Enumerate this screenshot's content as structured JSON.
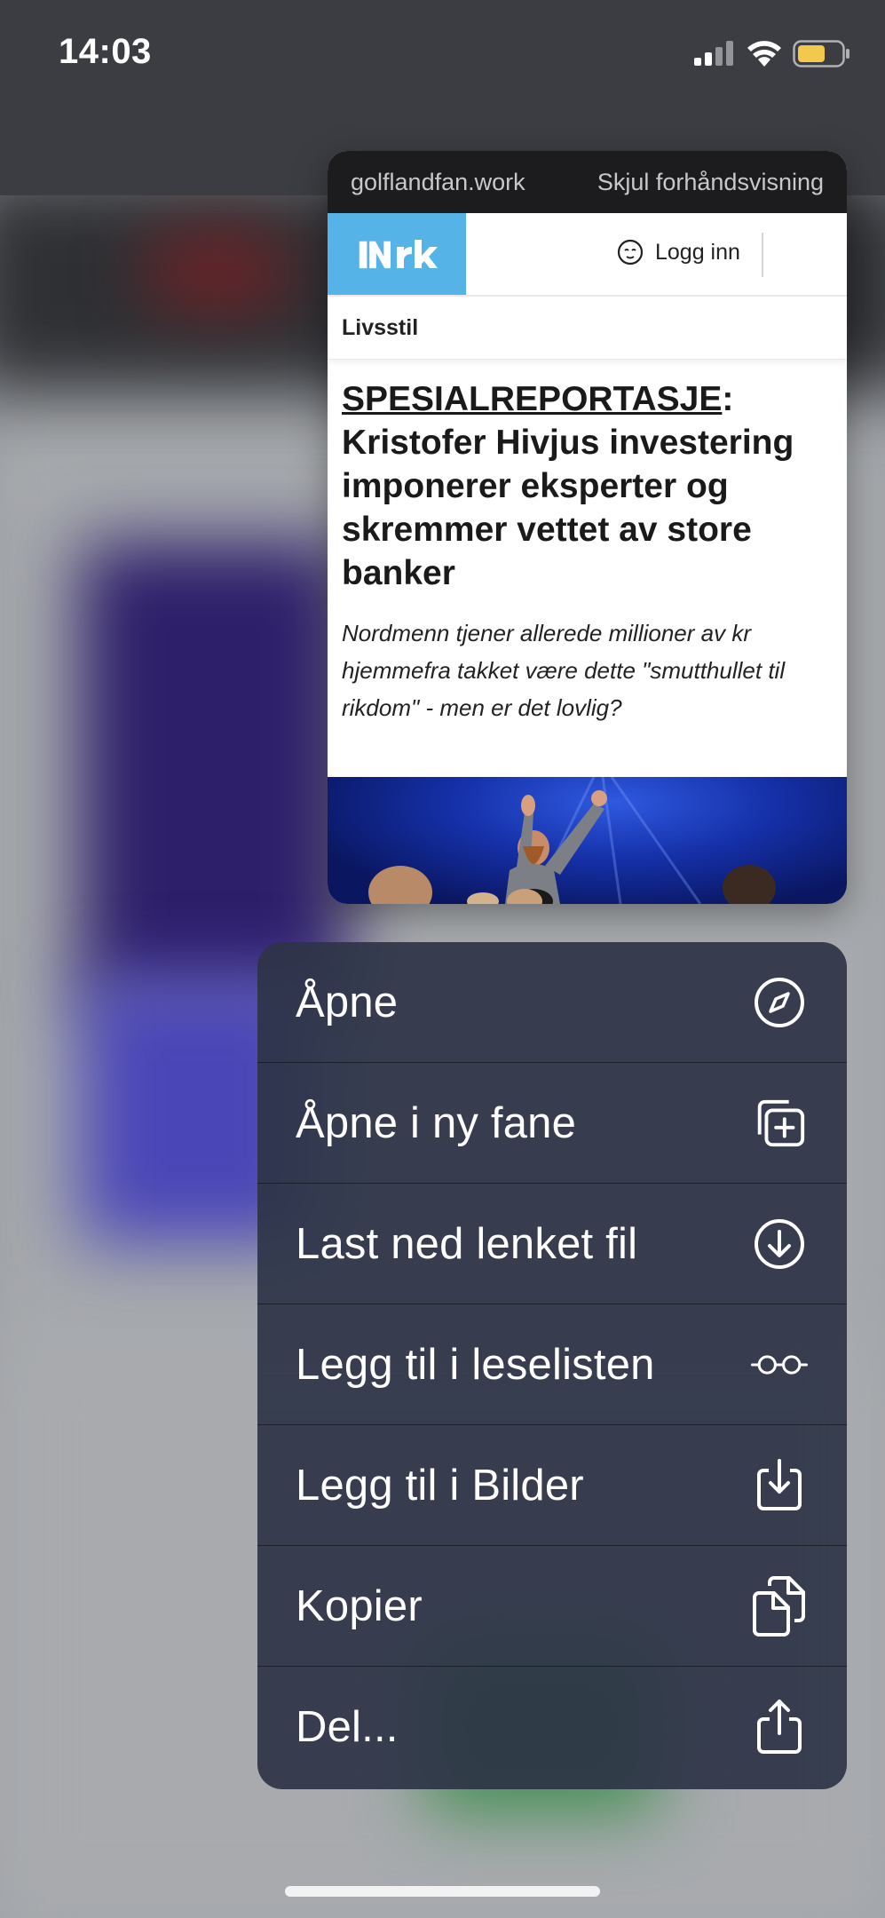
{
  "status_bar": {
    "time": "14:03",
    "battery_color": "#f2c94c"
  },
  "preview": {
    "site": "golflandfan.work",
    "hide_preview": "Skjul forhåndsvisning",
    "logo_text": "NRK",
    "logo_color": "#56b3e8",
    "login_label": "Logg inn",
    "section": "Livsstil",
    "headline_kicker": "SPESIALREPORTASJE",
    "headline_rest": ": Kristofer Hivjus investering imponerer eksperter og skremmer vettet av store banker",
    "lead": "Nordmenn tjener allerede millioner av kr hjemmefra takket være dette \"smutthullet til rikdom\" - men er det lovlig?"
  },
  "menu": {
    "items": [
      {
        "label": "Åpne",
        "icon": "compass-icon"
      },
      {
        "label": "Åpne i ny fane",
        "icon": "new-tab-icon"
      },
      {
        "label": "Last ned lenket fil",
        "icon": "download-circle-icon"
      },
      {
        "label": "Legg til i leselisten",
        "icon": "glasses-icon"
      },
      {
        "label": "Legg til i Bilder",
        "icon": "save-image-icon"
      },
      {
        "label": "Kopier",
        "icon": "copy-icon"
      },
      {
        "label": "Del...",
        "icon": "share-icon"
      }
    ]
  }
}
